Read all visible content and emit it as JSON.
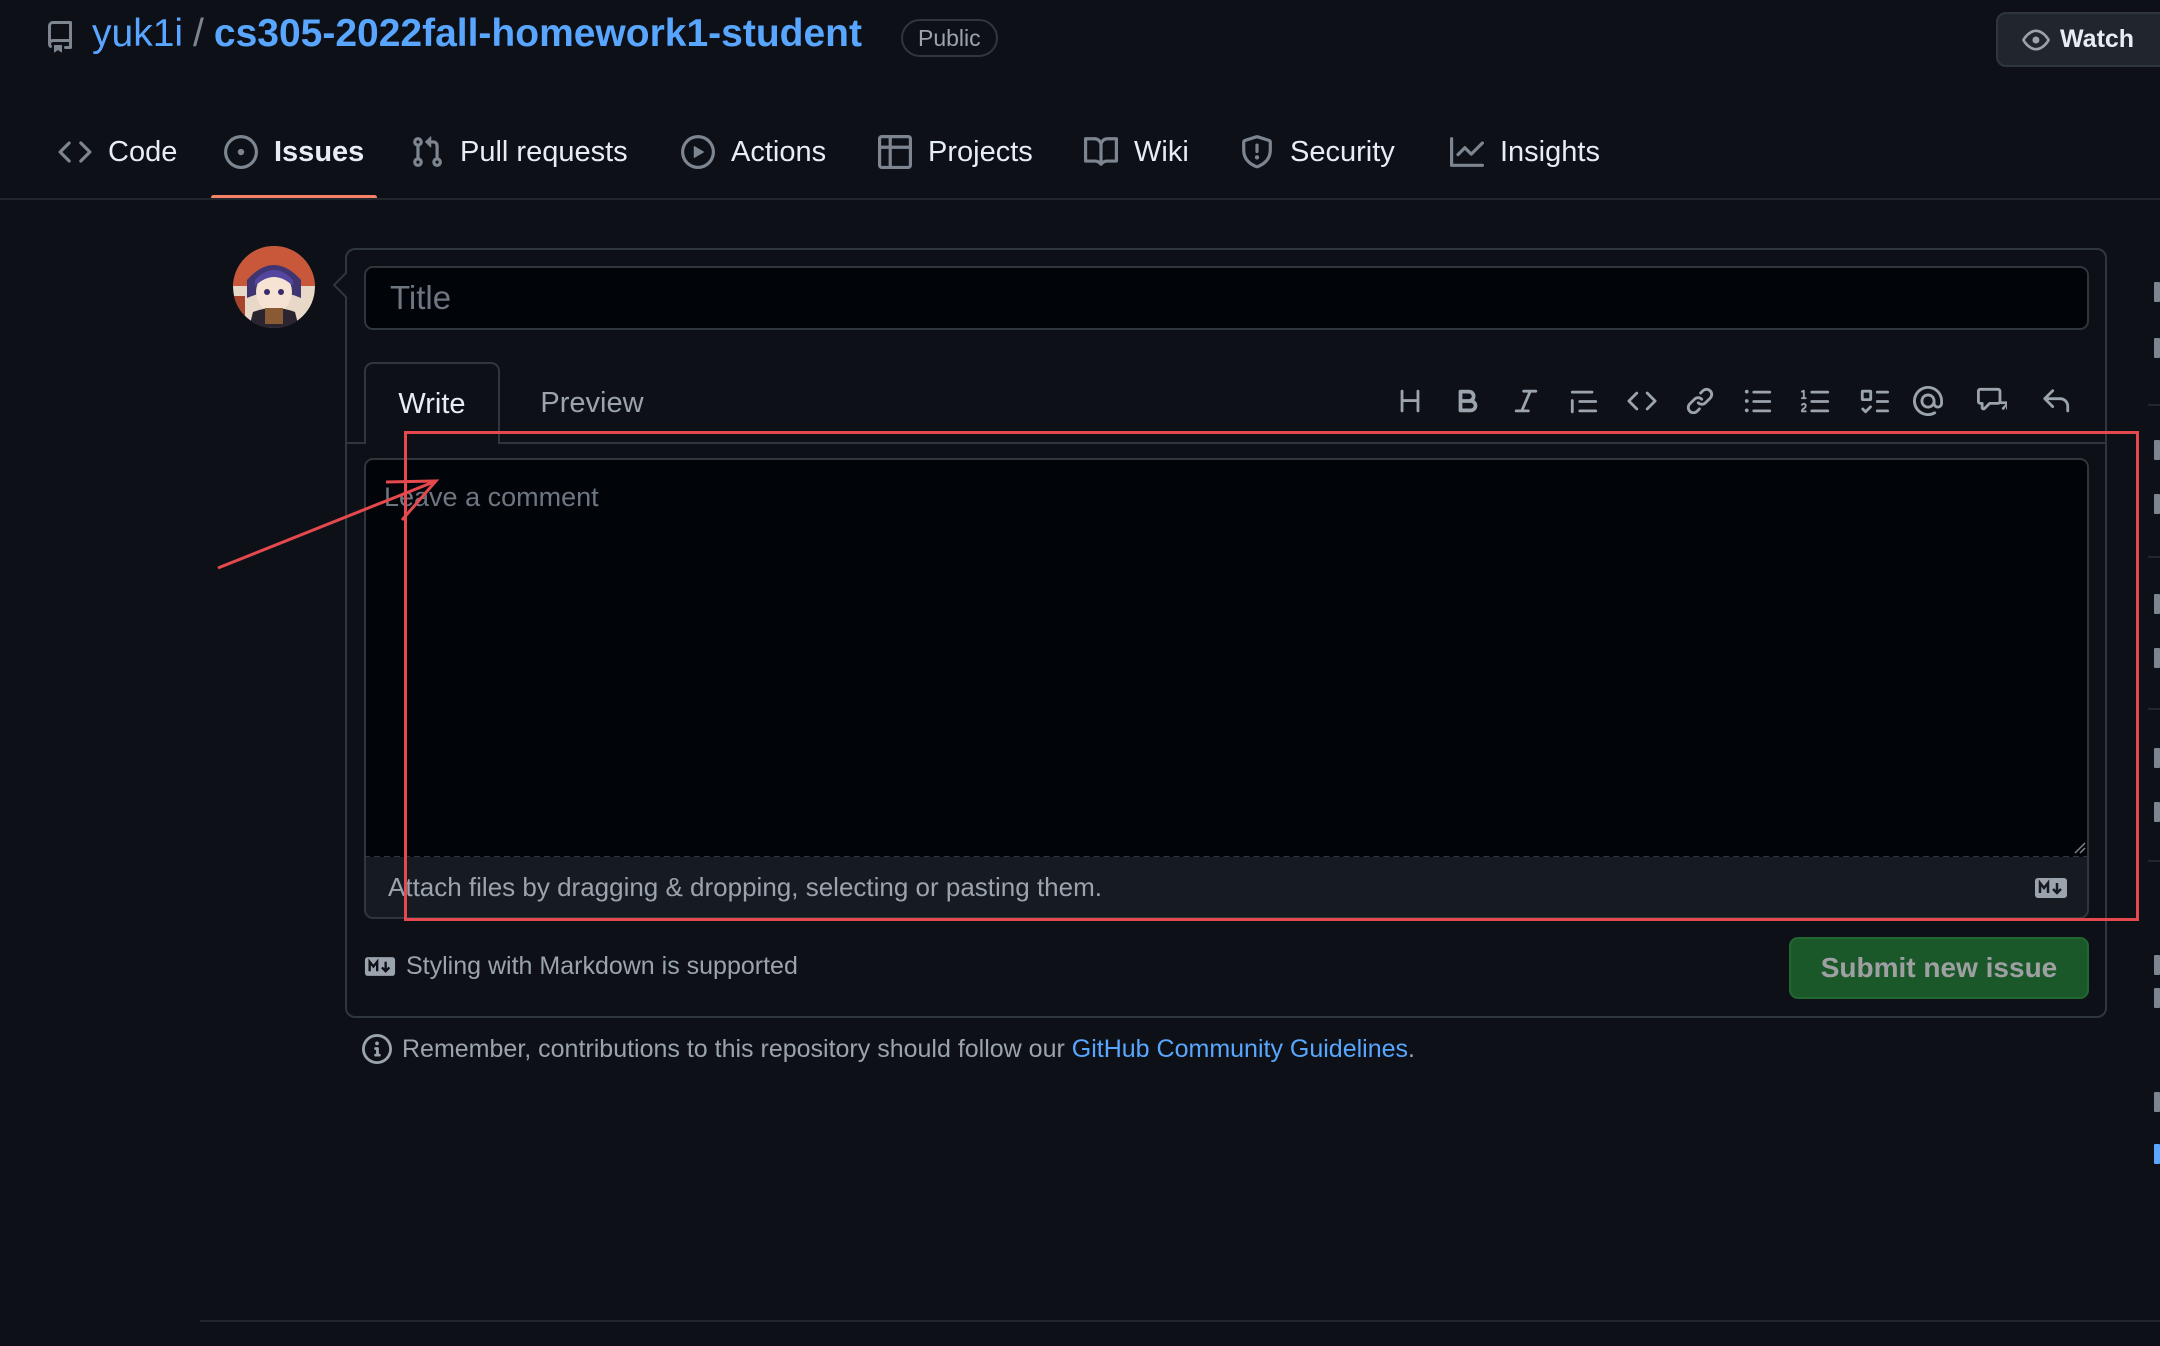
{
  "repo": {
    "owner": "yuk1i",
    "separator": "/",
    "name": "cs305-2022fall-homework1-student",
    "visibility": "Public"
  },
  "watch_button": {
    "label": "Watch"
  },
  "nav": {
    "tabs": [
      {
        "label": "Code",
        "icon": "code-icon"
      },
      {
        "label": "Issues",
        "icon": "issue-opened-icon",
        "active": true
      },
      {
        "label": "Pull requests",
        "icon": "git-pull-request-icon"
      },
      {
        "label": "Actions",
        "icon": "play-icon"
      },
      {
        "label": "Projects",
        "icon": "table-icon"
      },
      {
        "label": "Wiki",
        "icon": "book-icon"
      },
      {
        "label": "Security",
        "icon": "shield-icon"
      },
      {
        "label": "Insights",
        "icon": "graph-icon"
      }
    ]
  },
  "form": {
    "title_placeholder": "Title",
    "title_value": "",
    "tabs": {
      "write": "Write",
      "preview": "Preview"
    },
    "toolbar_icons": [
      "heading-icon",
      "bold-icon",
      "italic-icon",
      "quote-icon",
      "code-icon",
      "link-icon",
      "bulleted-list-icon",
      "numbered-list-icon",
      "task-list-icon",
      "mention-icon",
      "cross-reference-icon",
      "reply-icon"
    ],
    "comment_placeholder": "Leave a comment",
    "attach_text": "Attach files by dragging & dropping, selecting or pasting them.",
    "markdown_hint": "Styling with Markdown is supported",
    "submit_label": "Submit new issue"
  },
  "guidelines": {
    "prefix": "Remember, contributions to this repository should follow our",
    "link": "GitHub Community Guidelines",
    "suffix": "."
  },
  "colors": {
    "background": "#0d1117",
    "link": "#58a6ff",
    "active_tab_underline": "#f78166",
    "submit": "#238636",
    "annotation": "#e5484d"
  }
}
